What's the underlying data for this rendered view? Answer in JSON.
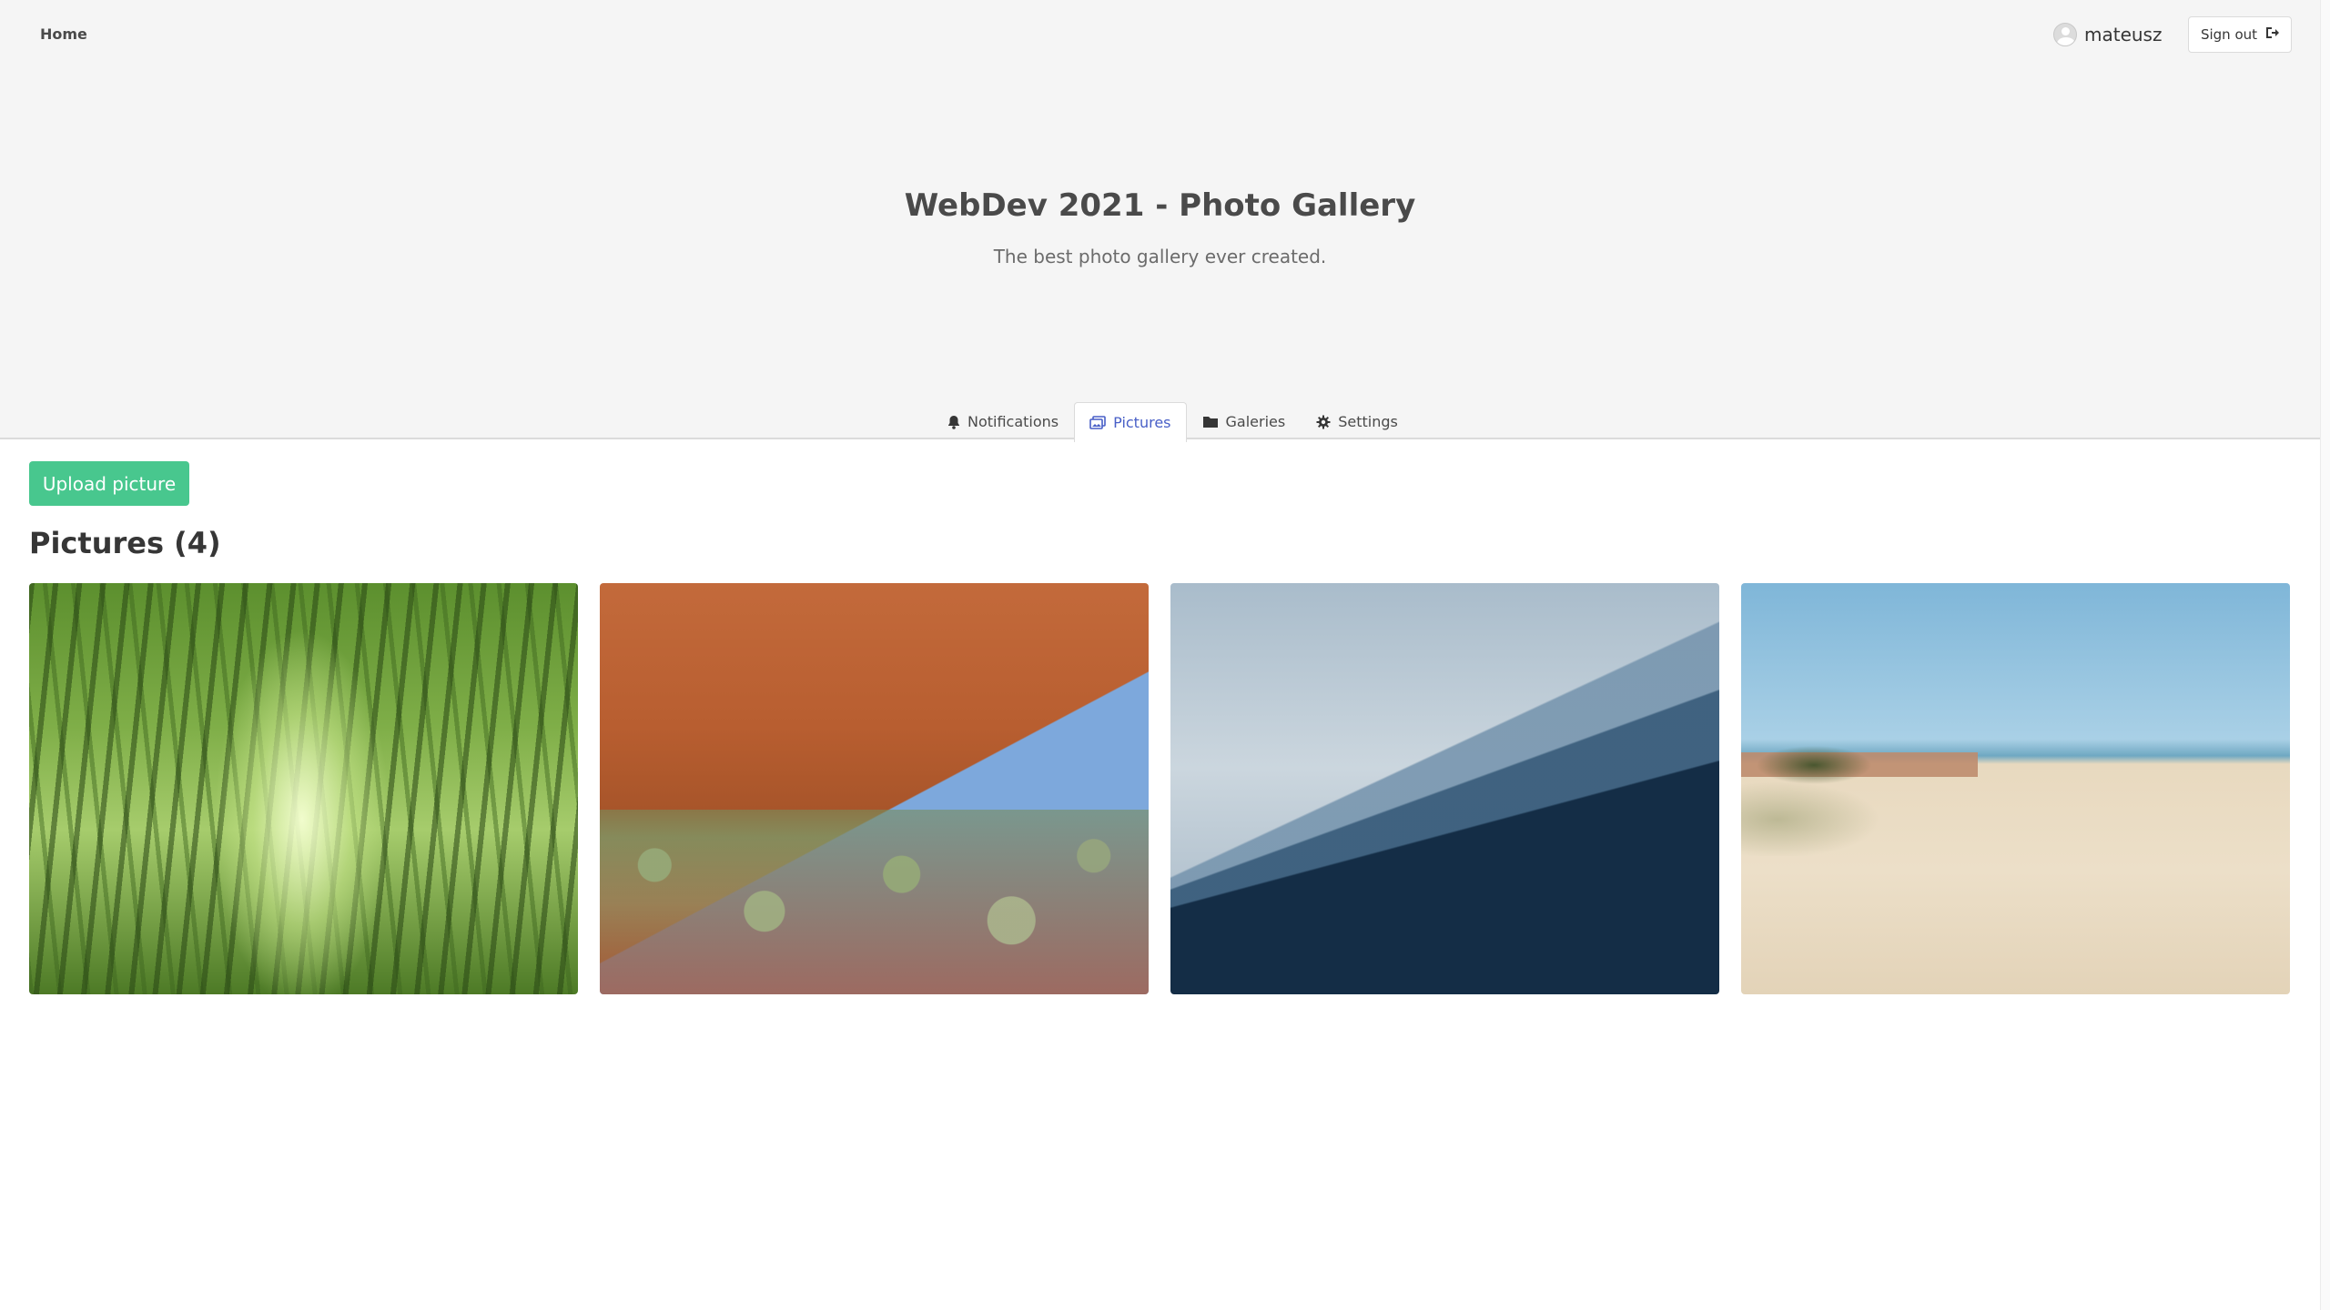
{
  "navbar": {
    "home_label": "Home",
    "username": "mateusz",
    "signout_label": "Sign out"
  },
  "hero": {
    "title": "WebDev 2021 - Photo Gallery",
    "subtitle": "The best photo gallery ever created."
  },
  "tabs": [
    {
      "label": "Notifications",
      "icon": "bell-icon",
      "active": false
    },
    {
      "label": "Pictures",
      "icon": "pictures-icon",
      "active": true
    },
    {
      "label": "Galeries",
      "icon": "folder-icon",
      "active": false
    },
    {
      "label": "Settings",
      "icon": "gear-icon",
      "active": false
    }
  ],
  "content": {
    "upload_label": "Upload picture",
    "section_title": "Pictures (4)"
  },
  "colors": {
    "hero_bg": "#f5f5f5",
    "upload_button": "#48c78e",
    "active_tab": "#485fc7"
  }
}
